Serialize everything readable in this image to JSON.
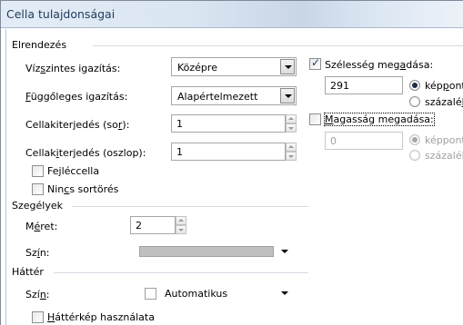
{
  "window": {
    "title": "Cella tulajdonságai"
  },
  "layout_section": {
    "heading": "Elrendezés",
    "h_align": {
      "label_pre": "Víz",
      "label_u": "s",
      "label_post": "zintes igazítás:",
      "value": "Középre"
    },
    "v_align": {
      "label_pre": "",
      "label_u": "F",
      "label_post": "üggőleges igazítás:",
      "value": "Alapértelmezett"
    },
    "padding_row": {
      "label_pre": "Cellakiterjedés (so",
      "label_u": "r",
      "label_post": "):",
      "value": "1"
    },
    "padding_col": {
      "label_pre": "Cellak",
      "label_u": "i",
      "label_post": "terjedés (oszlop):",
      "value": "1"
    },
    "header_cell": {
      "label_pre": "Fe",
      "label_u": "j",
      "label_post": "léccella",
      "checked": false
    },
    "no_wrap": {
      "label_pre": "Nin",
      "label_u": "c",
      "label_post": "s sortörés",
      "checked": false
    },
    "width": {
      "label_pre": "Szélesség meg",
      "label_u": "a",
      "label_post": "dása:",
      "checked": true,
      "value": "291",
      "unit_pixels": {
        "label_pre": "kép",
        "label_u": "p",
        "label_post": "ont",
        "selected": true
      },
      "unit_percent": {
        "label_pre": "százalé",
        "label_u": "k",
        "label_post": "",
        "selected": false
      }
    },
    "height": {
      "label_pre": "",
      "label_u": "M",
      "label_post": "agasság megadása:",
      "checked": false,
      "value": "0",
      "unit_pixels": {
        "label": "képpont",
        "selected": true
      },
      "unit_percent": {
        "label": "százalék",
        "selected": false
      }
    }
  },
  "borders_section": {
    "heading": "Szegélyek",
    "size": {
      "label_pre": "M",
      "label_u": "é",
      "label_post": "ret:",
      "value": "2"
    },
    "color": {
      "label_pre": "Sz",
      "label_u": "í",
      "label_post": "n:",
      "swatch": "#c0c0c0"
    }
  },
  "background_section": {
    "heading": "Háttér",
    "color": {
      "label_pre": "Szí",
      "label_u": "n",
      "label_post": ":",
      "value": "Automatikus"
    },
    "use_image": {
      "label_pre": "",
      "label_u": "H",
      "label_post": "áttérkép használata",
      "checked": false
    }
  }
}
